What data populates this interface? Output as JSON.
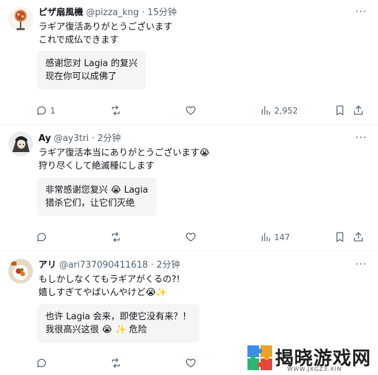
{
  "tweets": [
    {
      "name": "ピザ扇風機",
      "handle": "@pizza_kng",
      "time": "· 15分钟",
      "lines": [
        "ラギア復活ありがとうございます",
        "これで成仏できます"
      ],
      "translation": [
        "感谢您对 Lagia 的复兴",
        "现在你可以成佛了"
      ],
      "replies": "1",
      "retweets": "",
      "likes": "",
      "views": "2,952"
    },
    {
      "name": "Ay",
      "handle": "@ay3tri",
      "time": "· 2分钟",
      "lines": [
        "ラギア復活本当にありがとうございます😭",
        "狩り尽くして絶滅種にします"
      ],
      "translation": [
        "非常感谢您复兴 😭 Lagia",
        "猎杀它们，让它们灭绝"
      ],
      "replies": "",
      "retweets": "",
      "likes": "",
      "views": "147"
    },
    {
      "name": "アリ",
      "handle": "@ari737090411618",
      "time": "· 2分钟",
      "lines": [
        "もしかしなくてもラギアがくるの?!",
        "嬉しすぎてやばいんやけど😭✨"
      ],
      "translation": [
        "也许 Lagia 会来，即使它没有来？！",
        "我很高兴这很 😭 ✨ 危险"
      ],
      "replies": "",
      "retweets": "",
      "likes": "",
      "views": ""
    }
  ],
  "more_label": "···",
  "watermark": {
    "text": "揭晓游戏网",
    "url": "WWW.JXGZ3.XIN"
  },
  "icons": [
    "comment-icon",
    "retweet-icon",
    "like-icon",
    "views-icon",
    "bookmark-icon",
    "share-icon"
  ]
}
